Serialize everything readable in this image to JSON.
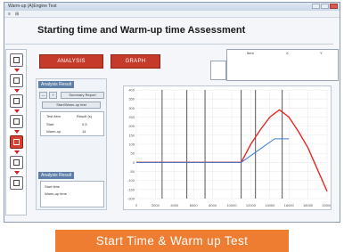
{
  "window": {
    "title": "Warm-up (A)Engine Test"
  },
  "menubar": {
    "items": [
      "≡",
      "⊞"
    ]
  },
  "app": {
    "title": "Starting time and Warm-up time Assessment"
  },
  "buttons": {
    "analysis": "ANALYSIS",
    "graph": "GRAPH"
  },
  "analysis_panel": {
    "header": "Analysis Result",
    "controls": [
      "—",
      "+",
      "Summary Report"
    ],
    "subheader": "Start/Warm-up test",
    "columns": [
      "Test item",
      "Result (s)"
    ],
    "rows": [
      [
        "Start",
        "0.5"
      ],
      [
        "Warm-up",
        "14"
      ]
    ]
  },
  "result_panel": {
    "header": "Analysis Result",
    "labels": [
      "Start time",
      "Warm-up time"
    ]
  },
  "legend_table": {
    "headers": [
      "Item",
      "X",
      "Y"
    ]
  },
  "colors": {
    "curve": "#e8271f",
    "signal": "#3a7bd5",
    "accent": "#c63a2c",
    "banner": "#ef7d31"
  },
  "chart_data": {
    "type": "line",
    "x_tick_labels": [
      "0",
      "2000",
      "4000",
      "6000",
      "8000",
      "10000",
      "12000",
      "14000",
      "16000",
      "18000",
      "20000"
    ],
    "y_tick_labels": [
      "400",
      "350",
      "300",
      "250",
      "200",
      "150",
      "100",
      "50",
      "0",
      "-50",
      "-100",
      "-150",
      "-200"
    ],
    "xlim": [
      0,
      20000
    ],
    "ylim": [
      -200,
      400
    ],
    "series": [
      {
        "x": [
          0,
          11000,
          12000,
          13000,
          14000,
          15000,
          16000,
          17000,
          18000,
          19000,
          20000
        ],
        "y": [
          0,
          0,
          100,
          180,
          250,
          290,
          250,
          170,
          80,
          -40,
          -160
        ],
        "color": "#e8271f"
      },
      {
        "x": [
          0,
          11000,
          14500,
          16000
        ],
        "y": [
          0,
          0,
          130,
          130
        ],
        "color": "#3a7bd5"
      }
    ],
    "vlines": [
      2700,
      5300,
      7200,
      11000,
      12500,
      15300
    ],
    "grid": true
  },
  "banner": {
    "text": "Start Time & Warm up Test"
  }
}
